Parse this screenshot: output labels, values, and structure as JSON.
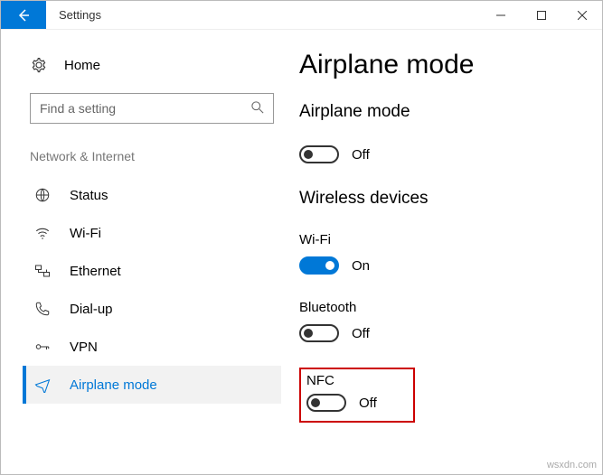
{
  "window": {
    "title": "Settings"
  },
  "sidebar": {
    "home": "Home",
    "search_placeholder": "Find a setting",
    "section": "Network & Internet",
    "items": [
      {
        "label": "Status"
      },
      {
        "label": "Wi-Fi"
      },
      {
        "label": "Ethernet"
      },
      {
        "label": "Dial-up"
      },
      {
        "label": "VPN"
      },
      {
        "label": "Airplane mode"
      }
    ]
  },
  "main": {
    "title": "Airplane mode",
    "airplane": {
      "heading": "Airplane mode",
      "state": "Off"
    },
    "wireless": {
      "heading": "Wireless devices",
      "wifi": {
        "label": "Wi-Fi",
        "state": "On"
      },
      "bluetooth": {
        "label": "Bluetooth",
        "state": "Off"
      },
      "nfc": {
        "label": "NFC",
        "state": "Off"
      }
    }
  },
  "watermark": "wsxdn.com"
}
